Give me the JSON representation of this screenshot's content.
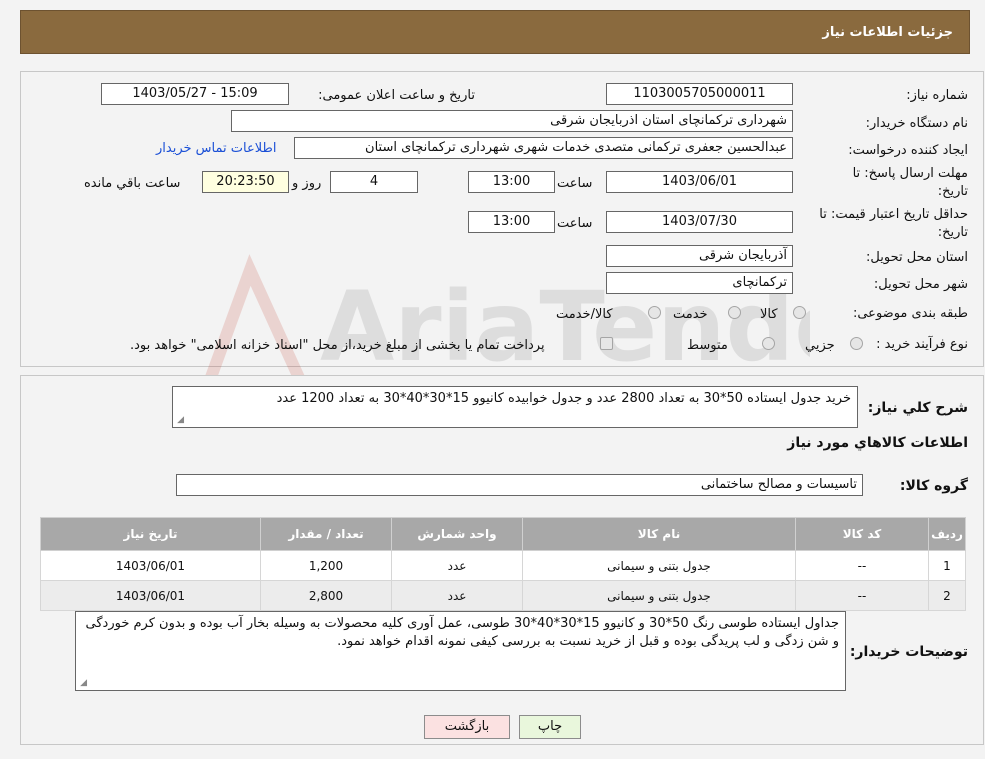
{
  "header": {
    "title": "جزئیات اطلاعات نیاز"
  },
  "form": {
    "need_number_label": "شماره نیاز:",
    "need_number": "1103005705000011",
    "announce_label": "تاریخ و ساعت اعلان عمومی:",
    "announce_value": "1403/05/27 - 15:09",
    "buyer_org_label": "نام دستگاه خریدار:",
    "buyer_org": "شهرداری ترکمانچای استان اذربایجان شرقی",
    "creator_label": "ایجاد کننده درخواست:",
    "creator": "عبدالحسین  جعفری ترکمانی  متصدی خدمات شهری  شهرداری ترکمانچای استان",
    "contact_link": "اطلاعات تماس خریدار",
    "deadline_label_1": "مهلت ارسال پاسخ: تا",
    "deadline_label_2": "تاریخ:",
    "deadline_date": "1403/06/01",
    "time_label": "ساعت",
    "deadline_time": "13:00",
    "days_value": "4",
    "days_label": "روز و",
    "remaining_time": "20:23:50",
    "remaining_label": "ساعت باقي مانده",
    "validity_label_1": "حداقل تاریخ اعتبار قیمت: تا",
    "validity_label_2": "تاریخ:",
    "validity_date": "1403/07/30",
    "validity_time": "13:00",
    "province_label": "استان محل تحویل:",
    "province": "آذربایجان شرقی",
    "city_label": "شهر محل تحویل:",
    "city": "ترکمانچای",
    "category_label": "طبقه بندی موضوعی:",
    "category_options": [
      "کالا",
      "خدمت",
      "کالا/خدمت"
    ],
    "process_label": "نوع فرآیند خرید :",
    "process_options": [
      "جزیي",
      "متوسط"
    ],
    "process_note": "پرداخت تمام یا بخشی از مبلغ خرید،از محل \"اسناد خزانه اسلامی\" خواهد بود."
  },
  "summary": {
    "label": "شرح کلي نیاز:",
    "text": "خرید جدول ایستاده 50*30 به تعداد 2800 عدد و جدول خوابیده کانیوو 15*30*40*30 به تعداد 1200 عدد",
    "goods_info_title": "اطلاعات کالاهاي مورد نیاز",
    "group_label": "گروه کالا:",
    "group_value": "تاسیسات و مصالح ساختمانی"
  },
  "table": {
    "headers": [
      "ردیف",
      "کد کالا",
      "نام کالا",
      "واحد شمارش",
      "تعداد / مقدار",
      "تاریخ نیاز"
    ],
    "rows": [
      [
        "1",
        "--",
        "جدول بتنی و سیمانی",
        "عدد",
        "1,200",
        "1403/06/01"
      ],
      [
        "2",
        "--",
        "جدول بتنی و سیمانی",
        "عدد",
        "2,800",
        "1403/06/01"
      ]
    ]
  },
  "notes": {
    "label": "توضیحات خریدار:",
    "text": "جداول ایستاده طوسی رنگ 50*30 و کانیوو 15*30*40*30 طوسی، عمل آوری کلیه محصولات به وسیله بخار آب بوده و بدون کرم خوردگی و شن زدگی و لب پریدگی بوده و قبل از خرید نسبت به بررسی کیفی نمونه اقدام خواهد نمود."
  },
  "buttons": {
    "print": "چاپ",
    "back": "بازگشت"
  },
  "colors": {
    "header_bg": "#8a6a3e",
    "print_button_bg": "#e9f7dc",
    "back_button_bg": "#fbe1e1",
    "remaining_bg": "#ffffe0"
  }
}
